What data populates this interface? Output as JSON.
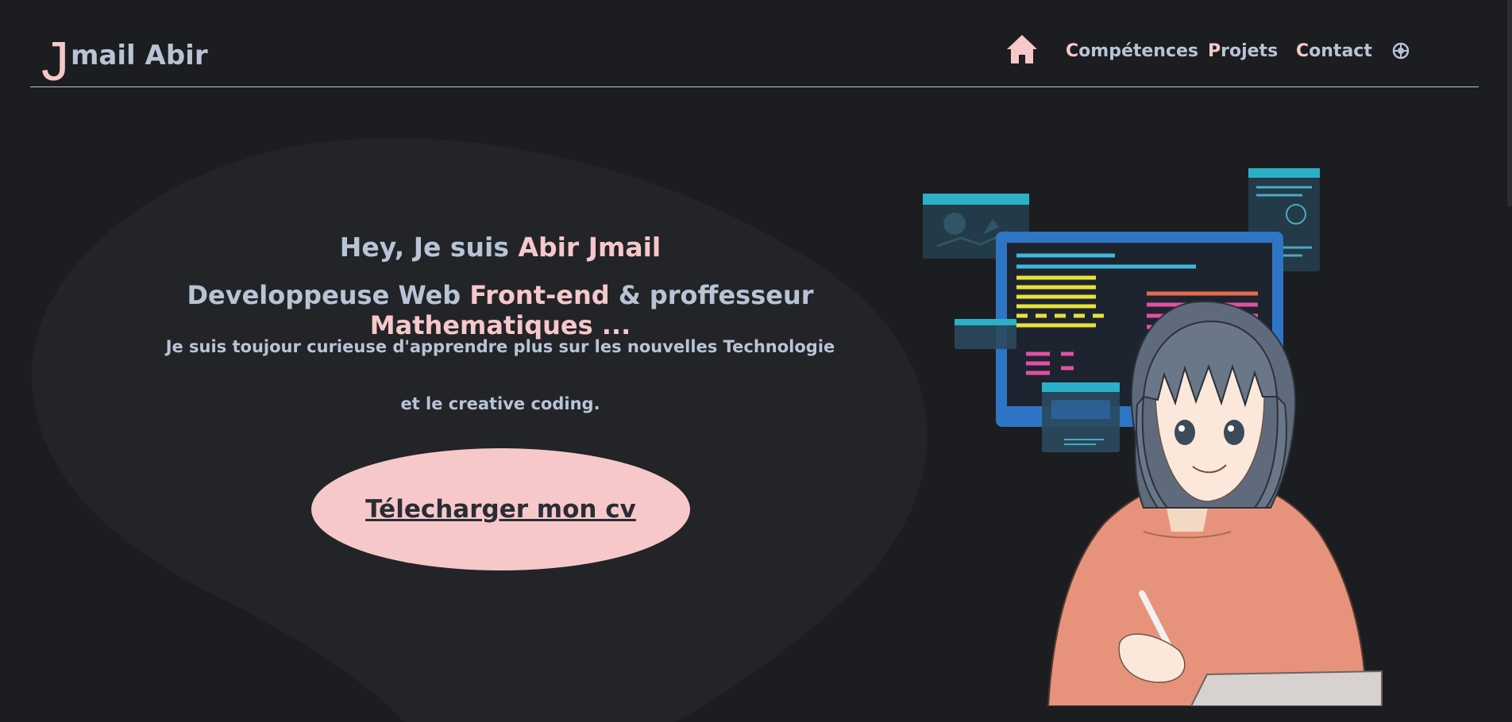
{
  "logo": {
    "initial": "J",
    "rest": "mail Abir"
  },
  "nav": {
    "home_icon": "home-icon",
    "items": [
      {
        "first": "C",
        "rest": "ompétences"
      },
      {
        "first": "P",
        "rest": "rojets"
      },
      {
        "first": "C",
        "rest": "ontact"
      }
    ],
    "theme_icon": "theme-toggle-icon"
  },
  "hero": {
    "greeting_prefix": "Hey, Je suis ",
    "name": "Abir Jmail",
    "role_a": "Developpeuse Web ",
    "role_b": "Front-end",
    "role_c": " & proffesseur ",
    "role_d": "Mathematiques ...",
    "line1": "Je suis toujour curieuse d'apprendre plus sur les nouvelles Technologie",
    "line2": "et le creative coding.",
    "cv_button": "Télecharger mon cv"
  },
  "colors": {
    "background": "#1c1d20",
    "accent": "#f7c8c9",
    "text": "#b8c4d6",
    "blob": "#222428"
  }
}
